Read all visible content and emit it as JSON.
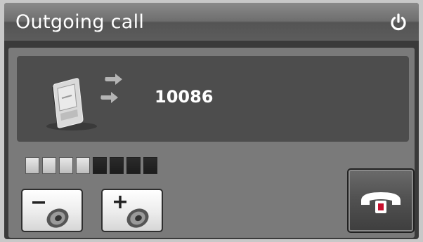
{
  "window": {
    "title": "Outgoing call"
  },
  "call": {
    "number": "10086",
    "status_icon": "outgoing-call-arrows-icon",
    "device_icon": "pda-phone-icon"
  },
  "volume": {
    "level": 4,
    "max": 8,
    "segments": [
      true,
      true,
      true,
      true,
      false,
      false,
      false,
      false
    ]
  },
  "controls": {
    "volume_down_icon": "volume-down-icon",
    "volume_up_icon": "volume-up-icon",
    "hangup_icon": "hang-up-icon",
    "power_icon": "power-icon",
    "hangup_color": "#c8102e"
  }
}
